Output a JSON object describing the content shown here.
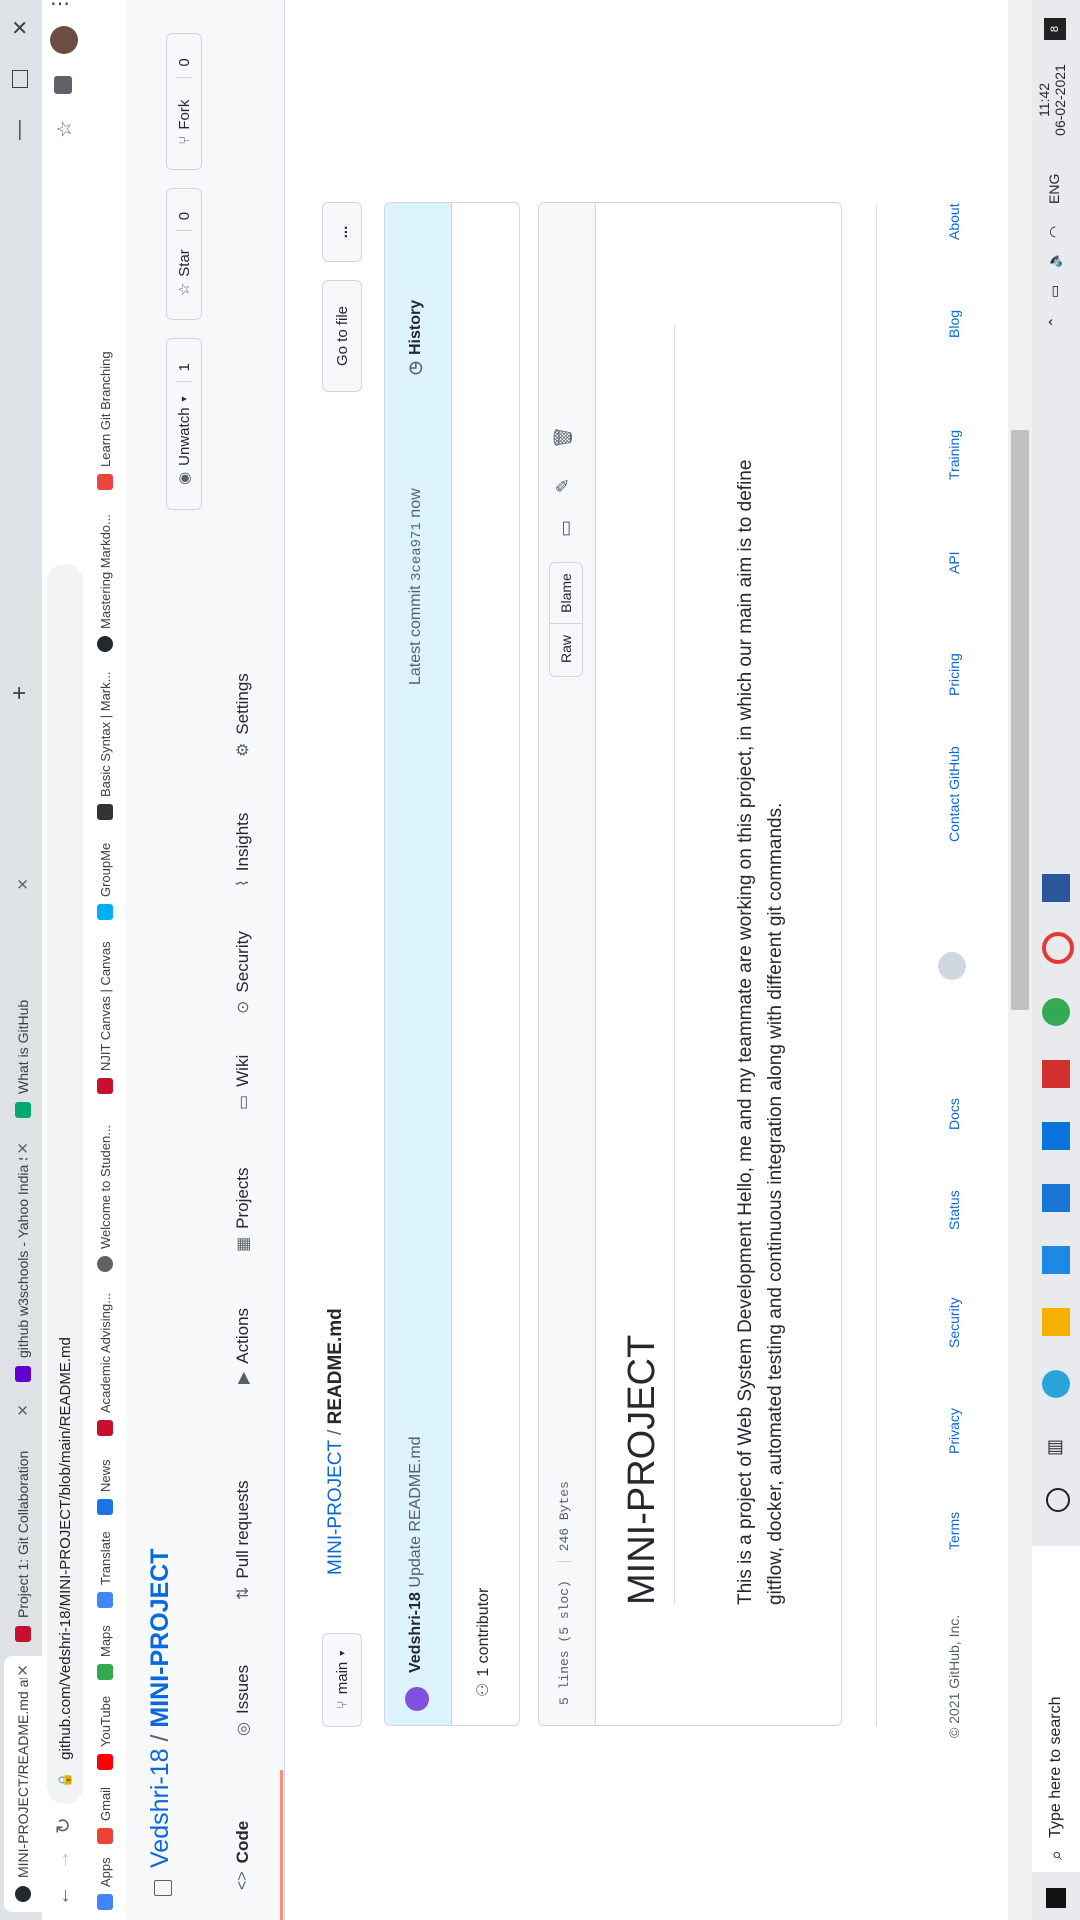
{
  "browser": {
    "tabs": [
      {
        "title": "MINI-PROJECT/README.md at m",
        "active": true
      },
      {
        "title": "Project 1: Git Collaboration",
        "active": false
      },
      {
        "title": "github w3schools - Yahoo India S",
        "active": false
      },
      {
        "title": "What is GitHub",
        "active": false
      }
    ],
    "new_tab_symbol": "+",
    "url": "github.com/Vedshri-18/MINI-PROJECT/blob/main/README.md",
    "bookmarks": [
      {
        "label": "Apps",
        "icon": "apps-grid-icon",
        "color": "#4285f4"
      },
      {
        "label": "Gmail",
        "icon": "gmail-icon",
        "color": "#ea4335"
      },
      {
        "label": "YouTube",
        "icon": "youtube-icon",
        "color": "#ff0000"
      },
      {
        "label": "Maps",
        "icon": "maps-icon",
        "color": "#34a853"
      },
      {
        "label": "Translate",
        "icon": "translate-icon",
        "color": "#4285f4"
      },
      {
        "label": "News",
        "icon": "news-icon",
        "color": "#1a73e8"
      },
      {
        "label": "Academic Advising...",
        "icon": "njit-icon",
        "color": "#c8102e"
      },
      {
        "label": "Welcome to Studen...",
        "icon": "globe-icon",
        "color": "#5f6368"
      },
      {
        "label": "NJIT Canvas | Canvas",
        "icon": "njit-icon",
        "color": "#c8102e"
      },
      {
        "label": "GroupMe",
        "icon": "groupme-icon",
        "color": "#00aff0"
      },
      {
        "label": "Basic Syntax | Mark...",
        "icon": "markdown-icon",
        "color": "#333333"
      },
      {
        "label": "Mastering Markdo...",
        "icon": "github-icon",
        "color": "#24292f"
      },
      {
        "label": "Learn Git Branching",
        "icon": "git-branching-icon",
        "color": "#e8453c"
      }
    ]
  },
  "repo": {
    "owner": "Vedshri-18",
    "slash": "/",
    "name": "MINI-PROJECT",
    "watch": {
      "label": "Unwatch",
      "count": "1"
    },
    "star": {
      "label": "Star",
      "count": "0"
    },
    "fork": {
      "label": "Fork",
      "count": "0"
    },
    "nav": [
      {
        "label": "Code",
        "icon": "code-icon"
      },
      {
        "label": "Issues",
        "icon": "issue-icon"
      },
      {
        "label": "Pull requests",
        "icon": "pull-request-icon"
      },
      {
        "label": "Actions",
        "icon": "actions-icon"
      },
      {
        "label": "Projects",
        "icon": "projects-icon"
      },
      {
        "label": "Wiki",
        "icon": "wiki-icon"
      },
      {
        "label": "Security",
        "icon": "security-icon"
      },
      {
        "label": "Insights",
        "icon": "insights-icon"
      },
      {
        "label": "Settings",
        "icon": "settings-icon"
      }
    ]
  },
  "file": {
    "branch": "main",
    "breadcrumb_repo": "MINI-PROJECT",
    "breadcrumb_sep": "/",
    "filename": "README.md",
    "go_to_file": "Go to file",
    "more": "...",
    "commit": {
      "author": "Vedshri-18",
      "message": "Update README.md",
      "latest_label": "Latest commit",
      "sha": "3cea971",
      "time": "now",
      "history": "History"
    },
    "contributors": "1 contributor",
    "lines": "5 lines (5 sloc)",
    "size": "246 Bytes",
    "raw": "Raw",
    "blame": "Blame"
  },
  "readme": {
    "title": "MINI-PROJECT",
    "line1": "This is a project of Web System Development Hello, me and my teammate are working on this project, in which our main aim is to define",
    "line2": "gitflow, docker, automated testing and continuous integration along with different git commands."
  },
  "footer": {
    "copyright": "© 2021 GitHub, Inc.",
    "links": [
      "Terms",
      "Privacy",
      "Security",
      "Status",
      "Docs",
      "Contact GitHub",
      "Pricing",
      "API",
      "Training",
      "Blog",
      "About"
    ]
  },
  "taskbar": {
    "search_placeholder": "Type here to search",
    "tray": {
      "lang": "ENG",
      "time": "11:42",
      "date": "06-02-2021",
      "notifications": "8"
    }
  },
  "colors": {
    "link": "#0969da",
    "accent_underline": "#fd8c73",
    "commit_bg": "#ddf4ff"
  }
}
